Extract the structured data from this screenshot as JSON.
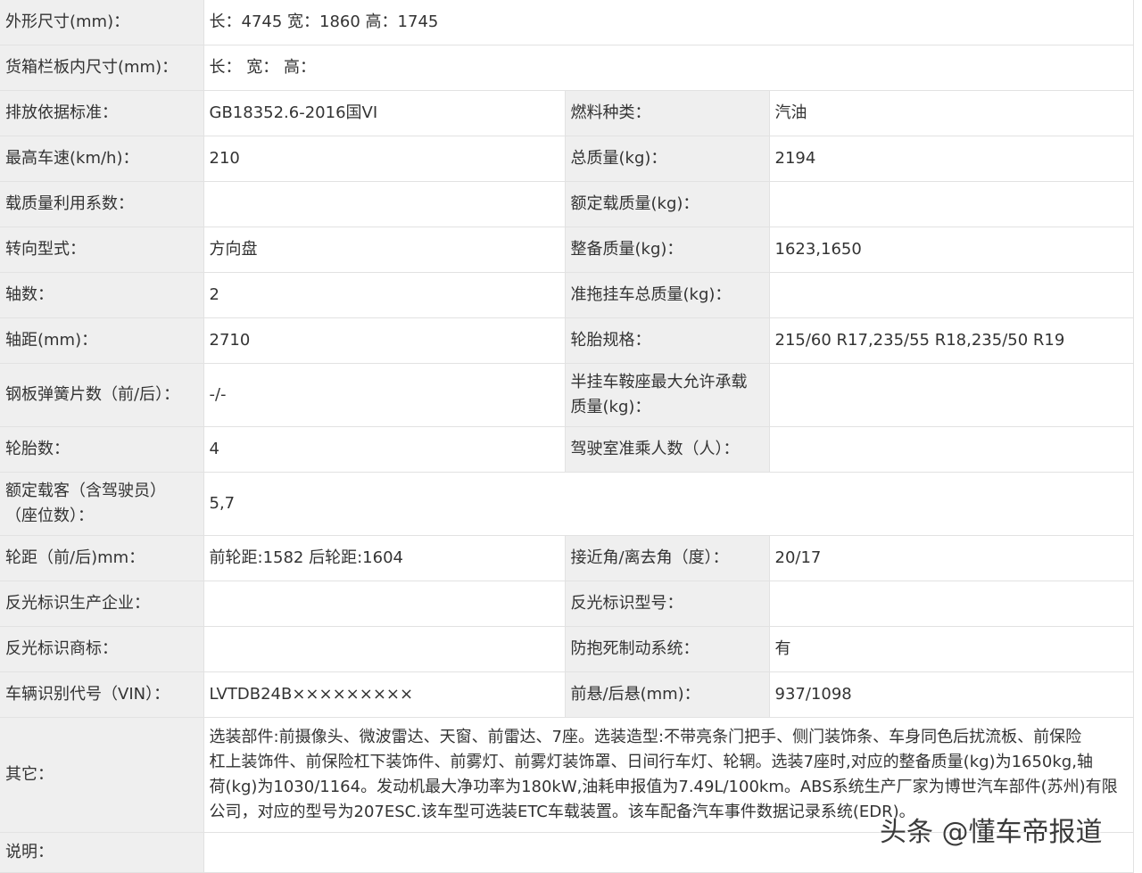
{
  "rows": {
    "dims": {
      "label": "外形尺寸(mm)：",
      "value": "长：4745 宽：1860 高：1745"
    },
    "cargo": {
      "label": "货箱栏板内尺寸(mm)：",
      "value": "长： 宽： 高："
    },
    "emission": {
      "label": "排放依据标准：",
      "value": "GB18352.6-2016国VI"
    },
    "fuel": {
      "label": "燃料种类：",
      "value": "汽油"
    },
    "maxspeed": {
      "label": "最高车速(km/h)：",
      "value": "210"
    },
    "totalmass": {
      "label": "总质量(kg)：",
      "value": "2194"
    },
    "loadcoef": {
      "label": "载质量利用系数：",
      "value": ""
    },
    "ratedload": {
      "label": "额定载质量(kg)：",
      "value": ""
    },
    "steering": {
      "label": "转向型式：",
      "value": "方向盘"
    },
    "curbmass": {
      "label": "整备质量(kg)：",
      "value": "1623,1650"
    },
    "axles": {
      "label": "轴数：",
      "value": "2"
    },
    "trailermass": {
      "label": "准拖挂车总质量(kg)：",
      "value": ""
    },
    "wheelbase": {
      "label": "轴距(mm)：",
      "value": "2710"
    },
    "tyrespec": {
      "label": "轮胎规格：",
      "value": "215/60 R17,235/55 R18,235/50 R19"
    },
    "leafspring": {
      "label": "钢板弹簧片数（前/后）：",
      "value": "-/-"
    },
    "saddle": {
      "label_line1": "半挂车鞍座最大允许承载",
      "label_line2": "质量(kg)：",
      "value": ""
    },
    "tyrecount": {
      "label": "轮胎数：",
      "value": "4"
    },
    "cabseats": {
      "label": "驾驶室准乘人数（人）：",
      "value": ""
    },
    "ratedpass": {
      "label_line1": "额定载客（含驾驶员）",
      "label_line2": "（座位数）：",
      "value": "5,7"
    },
    "track": {
      "label": "轮距（前/后)mm：",
      "value": "前轮距:1582 后轮距:1604"
    },
    "angles": {
      "label": "接近角/离去角（度）：",
      "value": "20/17"
    },
    "reflmaker": {
      "label": "反光标识生产企业：",
      "value": ""
    },
    "reflmodel": {
      "label": "反光标识型号：",
      "value": ""
    },
    "reflbrand": {
      "label": "反光标识商标：",
      "value": ""
    },
    "abs": {
      "label": "防抱死制动系统：",
      "value": "有"
    },
    "vin": {
      "label": "车辆识别代号（VIN）：",
      "value": "LVTDB24B×××××××××"
    },
    "overhang": {
      "label": "前悬/后悬(mm)：",
      "value": "937/1098"
    },
    "other": {
      "label": "其它：",
      "line1": "选装部件:前摄像头、微波雷达、天窗、前雷达、7座。选装造型:不带亮条门把手、侧门装饰条、车身同色后扰流板、前保险",
      "line2": "杠上装饰件、前保险杠下装饰件、前雾灯、前雾灯装饰罩、日间行车灯、轮辋。选装7座时,对应的整备质量(kg)为1650kg,轴",
      "line3": "荷(kg)为1030/1164。发动机最大净功率为180kW,油耗申报值为7.49L/100km。ABS系统生产厂家为博世汽车部件(苏州)有限",
      "line4": "公司，对应的型号为207ESC.该车型可选装ETC车载装置。该车配备汽车事件数据记录系统(EDR)。"
    },
    "notes": {
      "label": "说明：",
      "value": ""
    }
  },
  "watermark": "头条 @懂车帝报道"
}
